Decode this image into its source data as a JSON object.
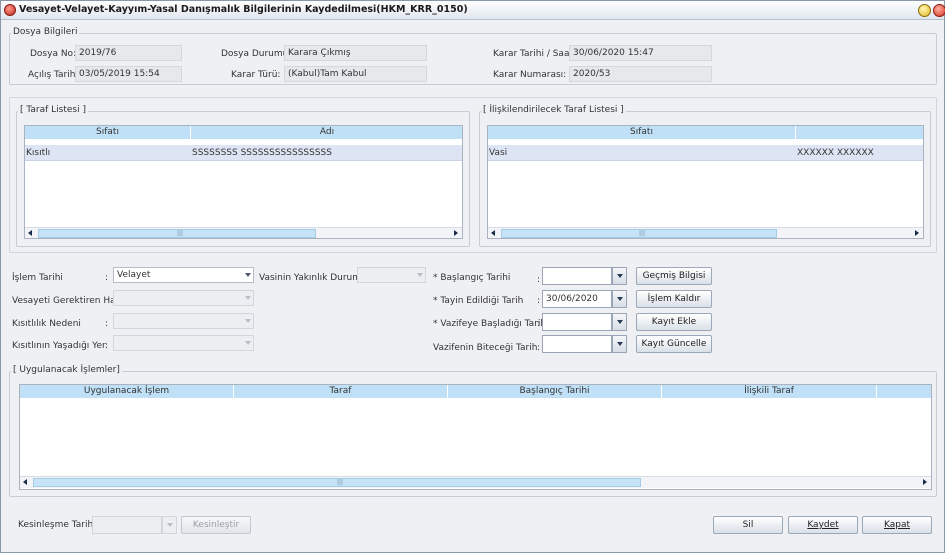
{
  "window": {
    "title": "Vesayet-Velayet-Kayyım-Yasal Danışmalık Bilgilerinin Kaydedilmesi(HKM_KRR_0150)"
  },
  "dosya": {
    "group_label": "Dosya Bilgileri",
    "dosya_no_label": "Dosya No:",
    "dosya_no": "2019/76",
    "acilis_label": "Açılış Tarihi:",
    "acilis": "03/05/2019 15:54",
    "durum_label": "Dosya Durumu:",
    "durum": "Karara Çıkmış",
    "karar_turu_label": "Karar Türü:",
    "karar_turu": "(Kabul)Tam Kabul",
    "karar_tarihi_label": "Karar Tarihi / Saati:",
    "karar_tarihi": "30/06/2020 15:47",
    "karar_no_label": "Karar Numarası:",
    "karar_no": "2020/53"
  },
  "taraf": {
    "group_label": "[ Taraf Listesi ]",
    "columns": [
      "Sıfatı",
      "Adı"
    ],
    "rows": [
      [
        "Kısıtlı",
        "SSSSSSSS SSSSSSSSSSSSSSSS"
      ]
    ]
  },
  "iliski": {
    "group_label": "[ İlişkilendirilecek Taraf Listesi ]",
    "columns": [
      "Sıfatı",
      ""
    ],
    "rows": [
      [
        "Vasi",
        "XXXXXX XXXXXX"
      ]
    ]
  },
  "form": {
    "islem_tarihi_label": "İşlem Tarihi",
    "islem_tarihi_value": "Velayet",
    "vesayet_hal_label": "Vesayeti Gerektiren Hal :",
    "kisitlilik_label": "Kısıtlılık Nedeni",
    "yer_label": "Kısıtlının Yaşadığı Yer",
    "yakinlik_label": "Vasinin Yakınlık Durumu",
    "baslangic_label": "* Başlangıç Tarihi",
    "baslangic_value": "",
    "tayin_label": "* Tayin Edildiği Tarih",
    "tayin_value": "30/06/2020",
    "vazife_bas_label": "* Vazifeye Başladığı Tarih",
    "vazife_bas_value": "",
    "vazife_bit_label": "Vazifenin Biteceği Tarih",
    "vazife_bit_value": "",
    "colon": ":"
  },
  "buttons": {
    "gecmis": "Geçmiş Bilgisi",
    "islem_kaldir": "İşlem Kaldır",
    "kayit_ekle": "Kayıt Ekle",
    "kayit_guncelle": "Kayıt Güncelle"
  },
  "uygulanacak": {
    "group_label": "[ Uygulanacak İşlemler]",
    "columns": [
      "Uygulanacak İşlem",
      "Taraf",
      "Başlangıç Tarihi",
      "İlişkili Taraf"
    ]
  },
  "footer": {
    "kesinlesme_label": "Kesinleşme Tarihi",
    "kesinlestir": "Kesinleştir",
    "sil": "Sil",
    "kaydet": "Kaydet",
    "kapat": "Kapat"
  },
  "scroll_grip": "|||"
}
